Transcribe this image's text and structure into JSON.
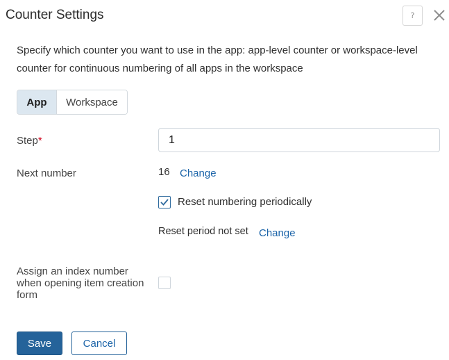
{
  "dialog": {
    "title": "Counter Settings",
    "help_glyph": "?",
    "description": "Specify which counter you want to use in the app: app-level counter or workspace-level counter for continuous numbering of all apps in the workspace"
  },
  "counter_scope": {
    "options": [
      "App",
      "Workspace"
    ],
    "selected": "App"
  },
  "step": {
    "label": "Step",
    "required_mark": "*",
    "value": "1"
  },
  "next_number": {
    "label": "Next number",
    "value": "16",
    "change_link": "Change"
  },
  "reset_numbering": {
    "label": "Reset numbering periodically",
    "checked": true
  },
  "reset_period": {
    "text": "Reset period not set",
    "change_link": "Change"
  },
  "assign_index": {
    "label": "Assign an index number when opening item creation form",
    "checked": false
  },
  "actions": {
    "save_label": "Save",
    "cancel_label": "Cancel"
  },
  "colors": {
    "primary": "#25639a",
    "link": "#1a63a8",
    "required": "#d0021b",
    "segment_selected_bg": "#dce7f0"
  },
  "icons": {
    "help": "question-mark-icon",
    "close": "close-x-icon",
    "check": "checkmark-icon"
  }
}
